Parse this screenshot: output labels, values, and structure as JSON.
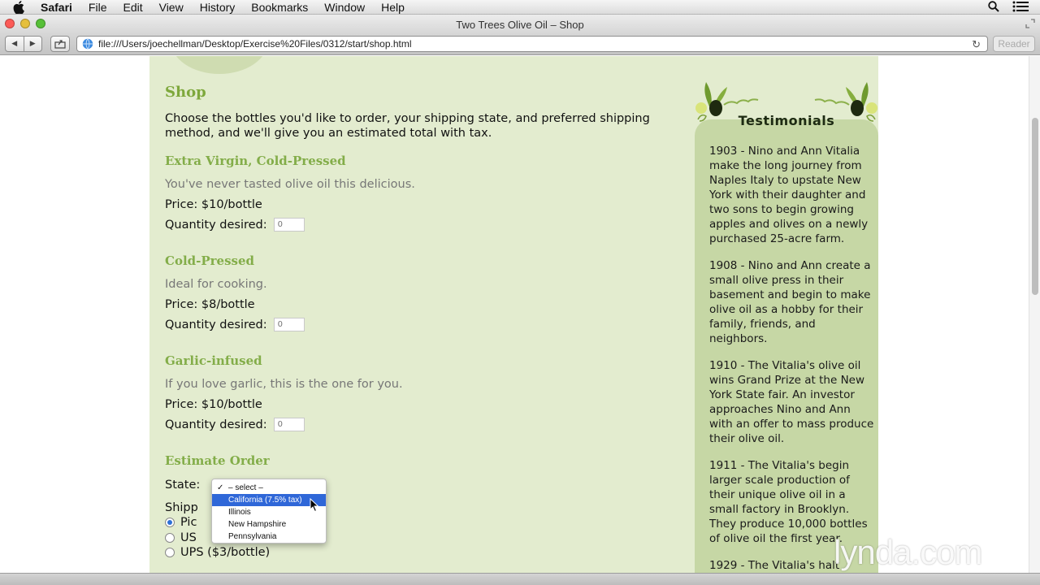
{
  "menubar": {
    "app": "Safari",
    "items": [
      "File",
      "Edit",
      "View",
      "History",
      "Bookmarks",
      "Window",
      "Help"
    ]
  },
  "window": {
    "title": "Two Trees Olive Oil – Shop"
  },
  "toolbar": {
    "url": "file:///Users/joechellman/Desktop/Exercise%20Files/0312/start/shop.html",
    "reader_label": "Reader"
  },
  "shop": {
    "heading": "Shop",
    "intro": "Choose the bottles you'd like to order, your shipping state, and preferred shipping method, and we'll give you an estimated total with tax.",
    "products": [
      {
        "name": "Extra Virgin, Cold-Pressed",
        "description": "You've never tasted olive oil this delicious.",
        "price": "Price: $10/bottle",
        "qty_label": "Quantity desired:",
        "qty_placeholder": "0"
      },
      {
        "name": "Cold-Pressed",
        "description": "Ideal for cooking.",
        "price": "Price: $8/bottle",
        "qty_label": "Quantity desired:",
        "qty_placeholder": "0"
      },
      {
        "name": "Garlic-infused",
        "description": "If you love garlic, this is the one for you.",
        "price": "Price: $10/bottle",
        "qty_label": "Quantity desired:",
        "qty_placeholder": "0"
      }
    ],
    "estimate_heading": "Estimate Order",
    "state_label": "State:",
    "shipping_label": "Shipp",
    "shipping_options": [
      "Pic",
      "US",
      "UPS ($3/bottle)"
    ],
    "state_options": [
      {
        "label": "– select –",
        "checked": true,
        "highlighted": false
      },
      {
        "label": "California (7.5% tax)",
        "checked": false,
        "highlighted": true
      },
      {
        "label": "Illinois",
        "checked": false,
        "highlighted": false
      },
      {
        "label": "New Hampshire",
        "checked": false,
        "highlighted": false
      },
      {
        "label": "Pennsylvania",
        "checked": false,
        "highlighted": false
      }
    ]
  },
  "sidebar": {
    "title": "Testimonials",
    "entries": [
      "1903 - Nino and Ann Vitalia make the long journey from Naples Italy to upstate New York with their daughter and two sons to begin growing apples and olives on a newly purchased 25-acre farm.",
      "1908 - Nino and Ann create a small olive press in their basement and begin to make olive oil as a hobby for their family, friends, and neighbors.",
      "1910 - The Vitalia's olive oil wins Grand Prize at the New York State fair. An investor approaches Nino and Ann with an offer to mass produce their olive oil.",
      "1911 - The Vitalia's begin larger scale production of their unique olive oil in a small factory in Brooklyn. They produce 10,000 bottles of olive oil the first year.",
      "1929 - The Vitalia's halt"
    ]
  },
  "watermark": "lynda.com",
  "colors": {
    "page_bg": "#e3eccf",
    "accent_green": "#7ea83c",
    "sidebar_bg": "#c6d7a5",
    "select_blue": "#2f67d8"
  }
}
